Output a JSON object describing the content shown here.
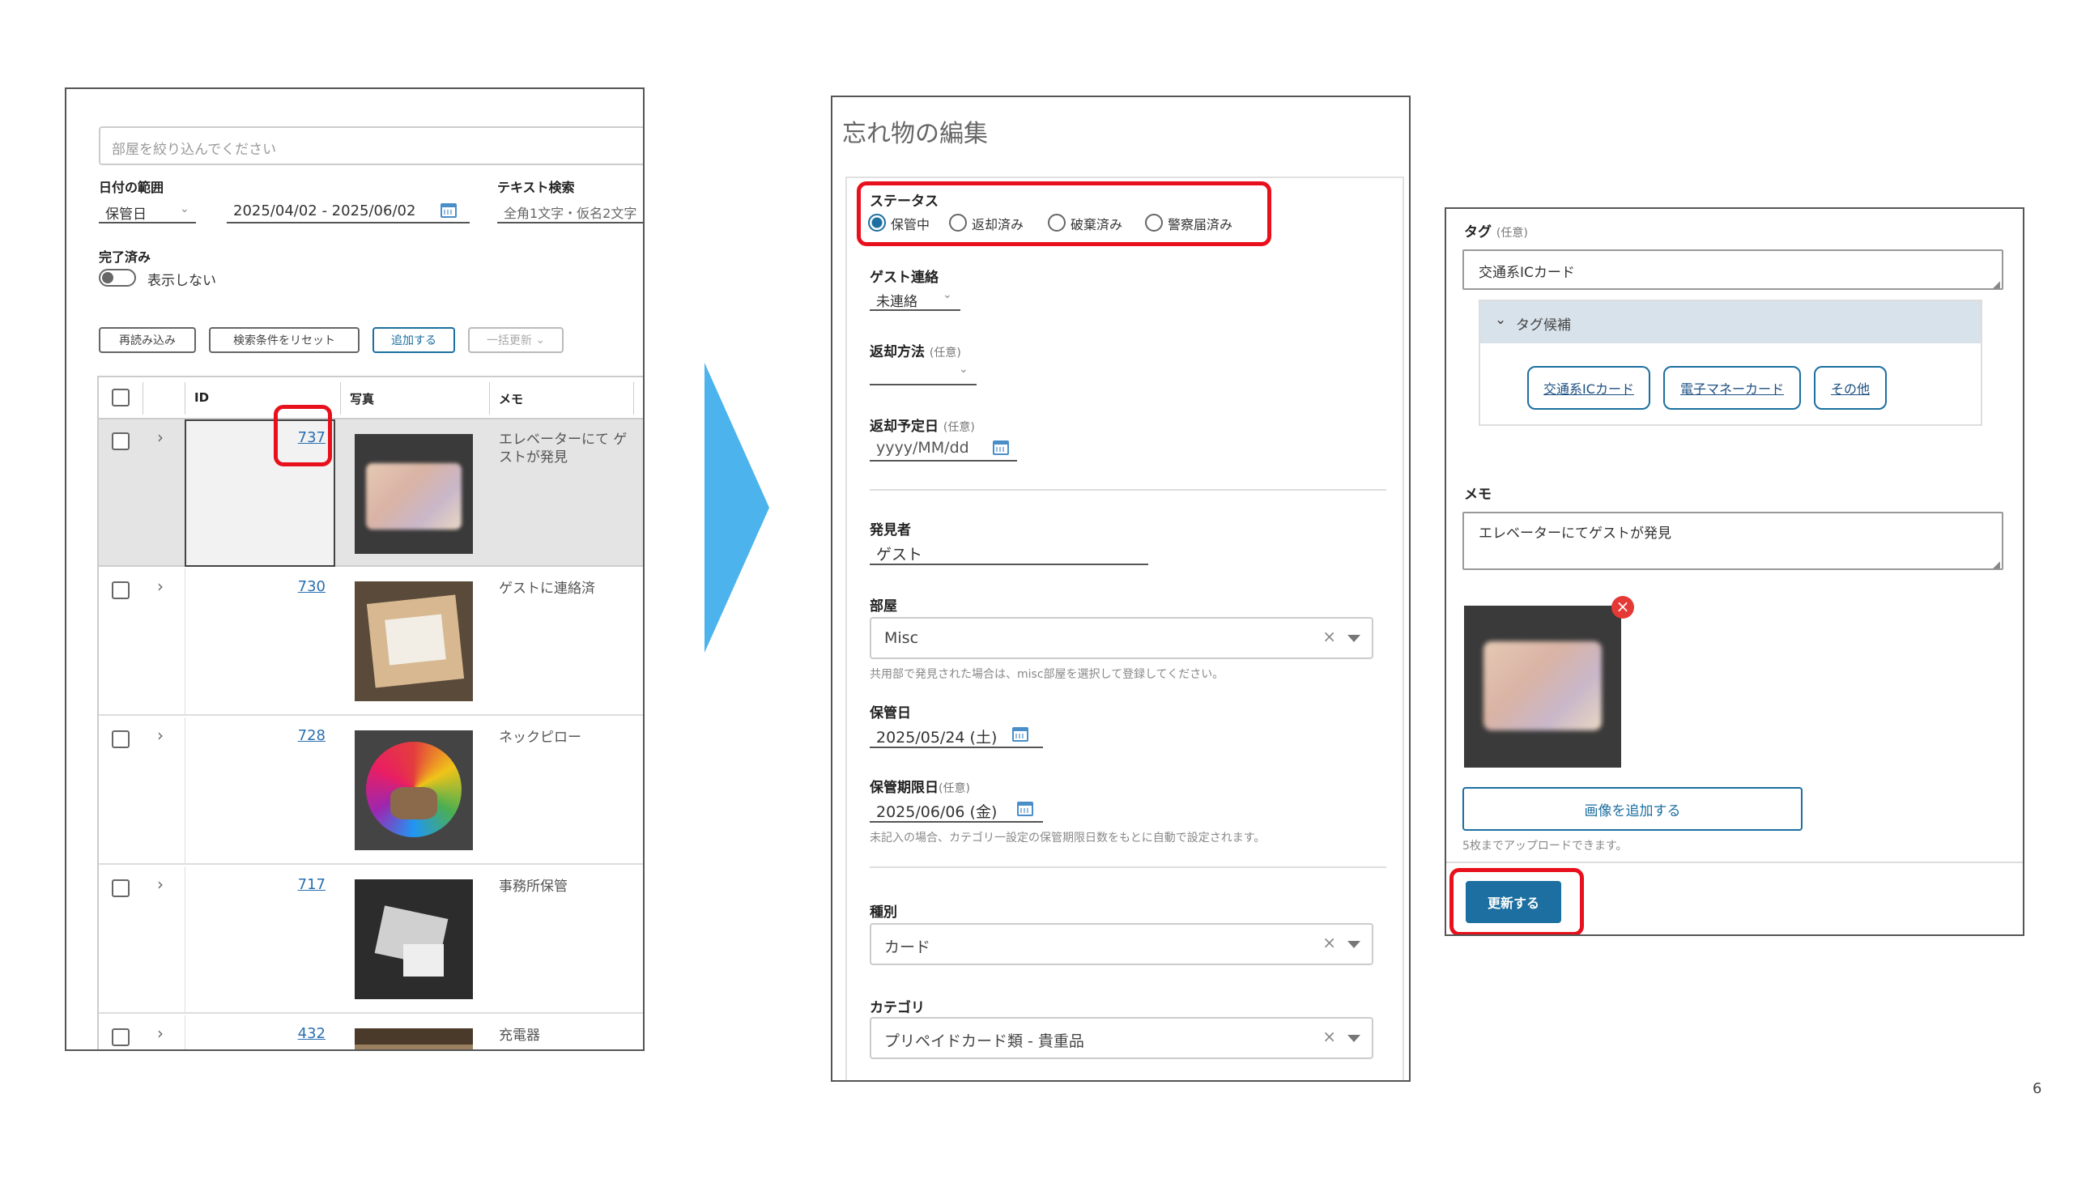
{
  "left_panel": {
    "room_filter_placeholder": "部屋を絞り込んでください",
    "date_range_label": "日付の範囲",
    "date_type_value": "保管日",
    "date_range_value": "2025/04/02 - 2025/06/02",
    "text_search_label": "テキスト検索",
    "text_search_placeholder": "全角1文字・仮名2文字",
    "completed_label": "完了済み",
    "completed_toggle_label": "表示しない",
    "buttons": {
      "reload": "再読み込み",
      "reset": "検索条件をリセット",
      "add": "追加する",
      "bulk": "一括更新"
    },
    "table": {
      "headers": {
        "id": "ID",
        "photo": "写真",
        "memo": "メモ"
      },
      "rows": [
        {
          "id": "737",
          "memo": "エレベーターにて ゲストが発見"
        },
        {
          "id": "730",
          "memo": "ゲストに連絡済"
        },
        {
          "id": "728",
          "memo": "ネックピロー"
        },
        {
          "id": "717",
          "memo": "事務所保管"
        },
        {
          "id": "432",
          "memo": "充電器"
        }
      ]
    }
  },
  "middle_panel": {
    "title": "忘れ物の編集",
    "status_label": "ステータス",
    "status_options": [
      "保管中",
      "返却済み",
      "破棄済み",
      "警察届済み"
    ],
    "status_selected": "保管中",
    "guest_contact_label": "ゲスト連絡",
    "guest_contact_value": "未連絡",
    "return_method_label": "返却方法",
    "optional": "(任意)",
    "return_date_label": "返却予定日",
    "return_date_placeholder": "yyyy/MM/dd",
    "finder_label": "発見者",
    "finder_value": "ゲスト",
    "room_label": "部屋",
    "room_value": "Misc",
    "room_help": "共用部で発見された場合は、misc部屋を選択して登録してください。",
    "storage_date_label": "保管日",
    "storage_date_value": "2025/05/24 (土)",
    "expiry_label": "保管期限日",
    "expiry_value": "2025/06/06 (金)",
    "expiry_help": "未記入の場合、カテゴリ一設定の保管期限日数をもとに自動で設定されます。",
    "type_label": "種別",
    "type_value": "カード",
    "category_label": "カテゴリ",
    "category_value": "プリペイドカード類 - 貴重品"
  },
  "right_panel": {
    "tag_label": "タグ",
    "optional": "(任意)",
    "tag_value": "交通系ICカード",
    "tag_candidates_label": "タグ候補",
    "tag_candidates": [
      "交通系ICカード",
      "電子マネーカード",
      "その他"
    ],
    "memo_label": "メモ",
    "memo_value": "エレベーターにてゲストが発見",
    "add_image_button": "画像を追加する",
    "upload_help": "5枚までアップロードできます。",
    "update_button": "更新する"
  },
  "page_number": "6",
  "colors": {
    "accent": "#1c6fa0",
    "highlight": "#e8101c",
    "arrow": "#4db3ec"
  }
}
